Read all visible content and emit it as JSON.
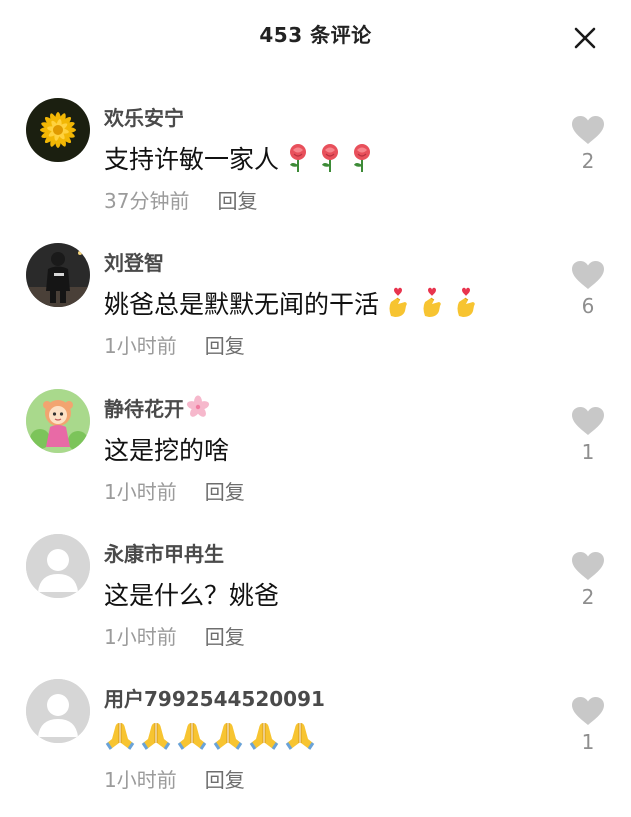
{
  "header": {
    "title": "453 条评论"
  },
  "comments": [
    {
      "username": "欢乐安宁",
      "text": "支持许敏一家人",
      "emoji_icon": "rose-icon",
      "emoji_count": 3,
      "time": "37分钟前",
      "reply_label": "回复",
      "likes": "2",
      "avatar_icon": "chrysanthemum-avatar-icon"
    },
    {
      "username": "刘登智",
      "text": "姚爸总是默默无闻的干活",
      "emoji_icon": "finger-heart-icon",
      "emoji_count": 3,
      "time": "1小时前",
      "reply_label": "回复",
      "likes": "6",
      "avatar_icon": "person-at-night-avatar-icon"
    },
    {
      "username": "静待花开",
      "username_suffix_icon": "cherry-blossom-icon",
      "text": "这是挖的啥",
      "time": "1小时前",
      "reply_label": "回复",
      "likes": "1",
      "avatar_icon": "cartoon-girl-avatar-icon"
    },
    {
      "username": "永康市甲冉生",
      "text": "这是什么？姚爸",
      "time": "1小时前",
      "reply_label": "回复",
      "likes": "2",
      "avatar_icon": "default-user-avatar-icon"
    },
    {
      "username": "用户7992544520091",
      "text": "",
      "emoji_icon": "folded-hands-icon",
      "emoji_count": 6,
      "time": "1小时前",
      "reply_label": "回复",
      "likes": "1",
      "avatar_icon": "default-user-avatar-icon"
    }
  ],
  "colors": {
    "like_heart": "#c8c8c8",
    "meta_text": "#9b9b9b",
    "username": "#4a4a4a"
  }
}
